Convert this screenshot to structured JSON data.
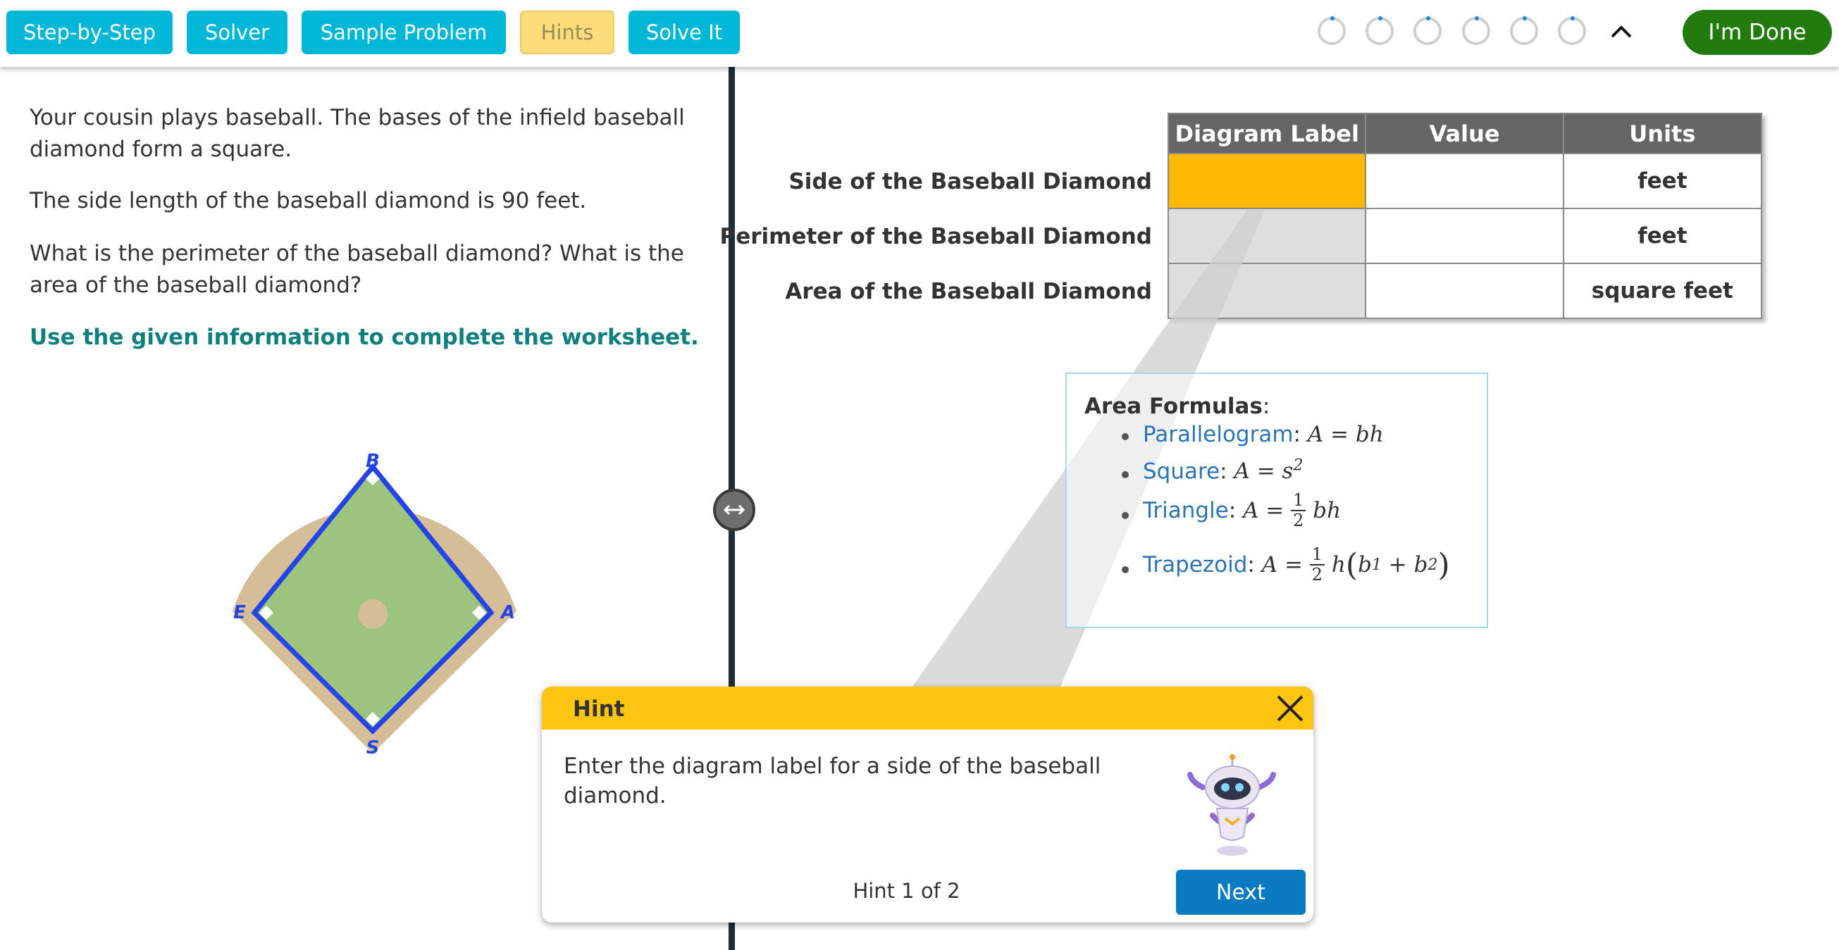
{
  "toolbar": {
    "buttons": [
      "Step-by-Step",
      "Solver",
      "Sample Problem",
      "Hints",
      "Solve It"
    ],
    "done_label": "I'm Done",
    "progress_steps": 6
  },
  "problem": {
    "p1": "Your cousin plays baseball. The bases of the infield baseball diamond form a square.",
    "p2": "The side length of the baseball diamond is 90 feet.",
    "p3": "What is the perimeter of the baseball diamond? What is the area of the baseball diamond?",
    "instruction": "Use the given information to complete the worksheet."
  },
  "diagram": {
    "labels": {
      "top": "B",
      "right": "A",
      "bottom": "S",
      "left": "E"
    }
  },
  "worksheet": {
    "headers": [
      "Diagram Label",
      "Value",
      "Units"
    ],
    "rows": [
      {
        "label": "Side of the Baseball Diamond",
        "units": "feet"
      },
      {
        "label": "Perimeter of the Baseball Diamond",
        "units": "feet"
      },
      {
        "label": "Area of the Baseball Diamond",
        "units": "square feet"
      }
    ]
  },
  "formulas": {
    "title": "Area Formulas",
    "items": [
      {
        "name": "Parallelogram"
      },
      {
        "name": "Square"
      },
      {
        "name": "Triangle"
      },
      {
        "name": "Trapezoid"
      }
    ]
  },
  "hint": {
    "title": "Hint",
    "text": "Enter the diagram label for a side of the baseball diamond.",
    "counter": "Hint 1 of 2",
    "next_label": "Next"
  },
  "colors": {
    "toolbar_button": "#00b7d8",
    "done_button": "#237a0f",
    "instruction": "#127f7f",
    "active_cell": "#ffb900",
    "hint_header": "#ffc510",
    "next_button": "#0a7bc1"
  }
}
